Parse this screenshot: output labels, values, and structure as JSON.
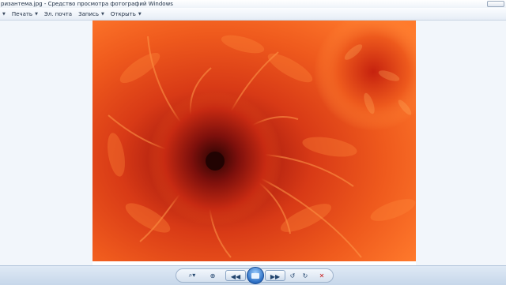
{
  "window": {
    "title": "ризантема.jpg - Средство просмотра фотографий Windows"
  },
  "menu": {
    "items": [
      {
        "label": "Печать"
      },
      {
        "label": "Эл. почта"
      },
      {
        "label": "Запись"
      },
      {
        "label": "Открыть"
      }
    ]
  },
  "photo": {
    "subject": "chrysanthemum flower",
    "colors": {
      "primary": "#e2461a",
      "highlight": "#ff8a3a",
      "center": "#8f140f"
    }
  },
  "toolbar": {
    "icons": [
      "zoom-icon",
      "fit-window-icon",
      "previous-icon",
      "slideshow-icon",
      "next-icon",
      "rotate-left-icon",
      "rotate-right-icon",
      "delete-icon"
    ]
  }
}
